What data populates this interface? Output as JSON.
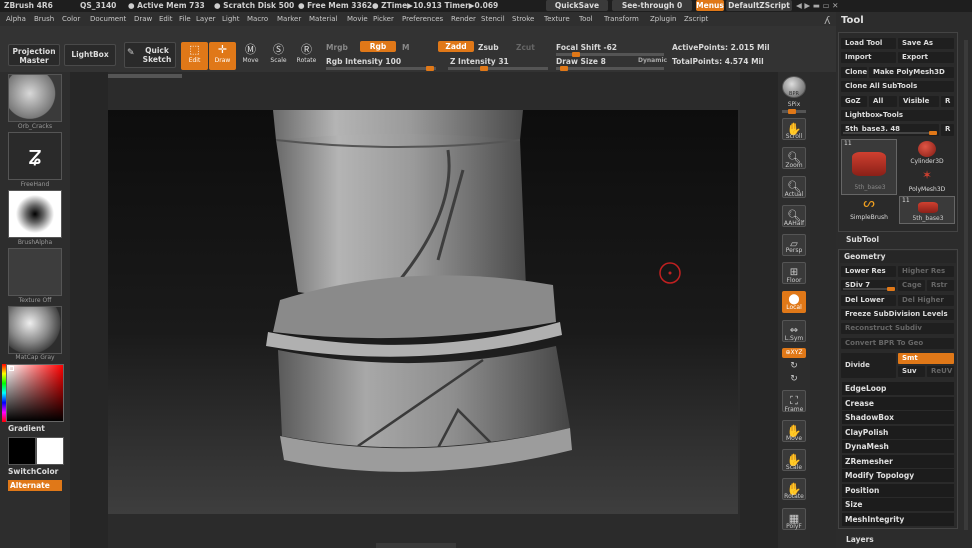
{
  "titlebar": {
    "app": "ZBrush 4R6",
    "qs": "QS_3140",
    "mem": "● Active Mem 733",
    "scratch": "● Scratch Disk 500",
    "free": "● Free Mem 3362",
    "ztime": "● ZTime▶10.913 Timer▶0.069",
    "quicksave": "QuickSave",
    "seethrough": "See-through",
    "seethrough_val": "0",
    "menus": "Menus",
    "script": "DefaultZScript"
  },
  "menus": [
    "Alpha",
    "Brush",
    "Color",
    "Document",
    "Draw",
    "Edit",
    "File",
    "Layer",
    "Light",
    "Macro",
    "Marker",
    "Material",
    "Movie",
    "Picker",
    "Preferences",
    "Render",
    "Stencil",
    "Stroke",
    "Texture",
    "Tool",
    "Transform",
    "Zplugin",
    "Zscript"
  ],
  "topbar": {
    "projection_master": "Projection Master",
    "lightbox": "LightBox",
    "quick_sketch": "Quick Sketch",
    "edit": "Edit",
    "draw": "Draw",
    "move": "Move",
    "scale": "Scale",
    "rotate": "Rotate",
    "mrgb": "Mrgb",
    "rgb": "Rgb",
    "m": "M",
    "rgb_intensity_label": "Rgb Intensity",
    "rgb_intensity": "100",
    "zadd": "Zadd",
    "zsub": "Zsub",
    "zcut": "Zcut",
    "z_intensity_label": "Z Intensity",
    "z_intensity": "31",
    "focal_shift_label": "Focal Shift",
    "focal_shift": "-62",
    "draw_size_label": "Draw Size",
    "draw_size": "8",
    "dynamic": "Dynamic",
    "active_points_label": "ActivePoints:",
    "active_points": "2.015 Mil",
    "total_points_label": "TotalPoints:",
    "total_points": "4.574 Mil"
  },
  "leftshelf": {
    "brush_material": "Orb_Cracks",
    "stroke": "FreeHand",
    "alpha": "BrushAlpha",
    "texture": "Texture Off",
    "matcap": "MatCap Gray",
    "gradient": "Gradient",
    "switchcolor": "SwitchColor",
    "alternate": "Alternate"
  },
  "rightshelf": {
    "bpr": "BPR",
    "spix": "SPix",
    "scroll": "Scroll",
    "zoom": "Zoom",
    "actual": "Actual",
    "aahalf": "AAHalf",
    "persp": "Persp",
    "floor": "Floor",
    "local": "Local",
    "lsym": "L.Sym",
    "xyz": "⊕XYZ",
    "frame": "Frame",
    "move": "Move",
    "scale": "Scale",
    "rotate": "Rotate",
    "polyf": "PolyF"
  },
  "tool_panel": {
    "title": "Tool",
    "load_tool": "Load Tool",
    "save_as": "Save As",
    "import": "Import",
    "export": "Export",
    "clone": "Clone",
    "make_polymesh": "Make PolyMesh3D",
    "clone_all": "Clone All SubTools",
    "goz": "GoZ",
    "all": "All",
    "visible": "Visible",
    "r": "R",
    "lightbox_tools": "Lightbox▸Tools",
    "current_tool": "5th_base3. 48",
    "thumb_count1": "11",
    "thumb_count2": "11",
    "thumbs": [
      "5th_base3",
      "Cylinder3D",
      "PolyMesh3D",
      "SimpleBrush",
      "5th_base3"
    ],
    "subtool": "SubTool",
    "geometry": "Geometry",
    "lower_res": "Lower Res",
    "higher_res": "Higher Res",
    "sdiv": "SDiv 7",
    "cage": "Cage",
    "rstr": "Rstr",
    "del_lower": "Del Lower",
    "del_higher": "Del Higher",
    "freeze": "Freeze SubDivision Levels",
    "reconstruct": "Reconstruct Subdiv",
    "convert_bpr": "Convert BPR To Geo",
    "divide": "Divide",
    "smt": "Smt",
    "suv": "Suv",
    "reuv": "ReUV",
    "subsections": [
      "EdgeLoop",
      "Crease",
      "ShadowBox",
      "ClayPolish",
      "DynaMesh",
      "ZRemesher",
      "Modify Topology",
      "Position",
      "Size",
      "MeshIntegrity"
    ],
    "layers": "Layers"
  },
  "colors": {
    "accent": "#e07818"
  }
}
